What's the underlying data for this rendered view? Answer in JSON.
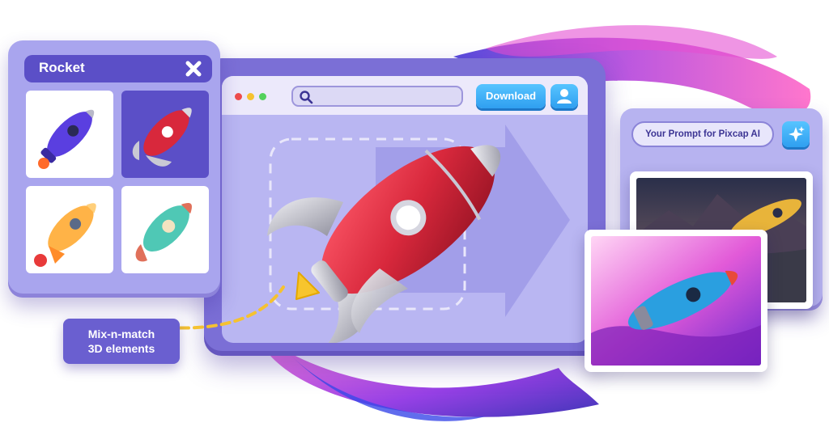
{
  "left_panel": {
    "title": "Rocket",
    "close_icon": "close-icon",
    "tiles": [
      {
        "name": "purple rocket",
        "selected": false
      },
      {
        "name": "red rocket",
        "selected": true
      },
      {
        "name": "orange rocket",
        "selected": false
      },
      {
        "name": "teal rocket",
        "selected": false
      }
    ]
  },
  "main_window": {
    "search": {
      "placeholder": "",
      "icon": "search-icon"
    },
    "download_label": "Download",
    "user_icon": "user-icon",
    "window_controls": [
      "close",
      "minimize",
      "maximize"
    ]
  },
  "right_panel": {
    "prompt": "Your Prompt for Pixcap AI",
    "sparkle_icon": "sparkle-icon"
  },
  "callout": {
    "line1": "Mix-n-match",
    "line2": "3D elements"
  },
  "colors": {
    "brand_purple": "#7b6fd6",
    "accent_blue": "#2f9ff0",
    "rocket_red": "#d8283c"
  }
}
